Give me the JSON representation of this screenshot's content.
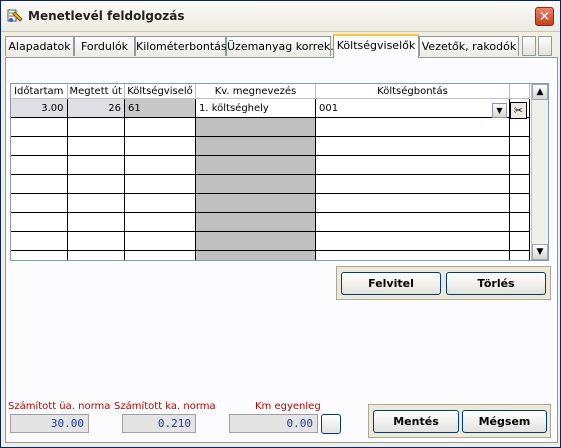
{
  "window": {
    "title": "Menetlevél feldolgozás",
    "close_glyph": "✕",
    "icon": "app-icon"
  },
  "tabs": [
    {
      "label": "Alapadatok"
    },
    {
      "label": "Fordulók"
    },
    {
      "label": "Kilométerbontás"
    },
    {
      "label": "Üzemanyag korrek."
    },
    {
      "label": "Költségviselők"
    },
    {
      "label": "Vezetők, rakodók"
    }
  ],
  "grid": {
    "columns": [
      "Időtartam",
      "Megtett út",
      "Költségviselő",
      "Kv. megnevezés",
      "Költségbontás"
    ],
    "rows": [
      {
        "idotartam": "3.00",
        "megtett_ut": "26",
        "koltsegviselo": "61",
        "kv_megnevezes": "1. költséghely",
        "koltsegbontas": "001"
      }
    ],
    "scroll_up": "▲",
    "scroll_down": "▼",
    "combo_arrow": "▼",
    "cut_glyph": "✂"
  },
  "actions": {
    "felvitel": "Felvitel",
    "torles": "Törlés",
    "mentes": "Mentés",
    "megsem": "Mégsem"
  },
  "footer": {
    "szamitott_ua_label": "Számított üa. norma",
    "szamitott_ua_value": "30.00",
    "szamitott_ka_label": "Számított ka. norma",
    "szamitott_ka_value": "0.210",
    "km_egyenleg_label": "Km egyenleg",
    "km_egyenleg_value": "0.00"
  }
}
